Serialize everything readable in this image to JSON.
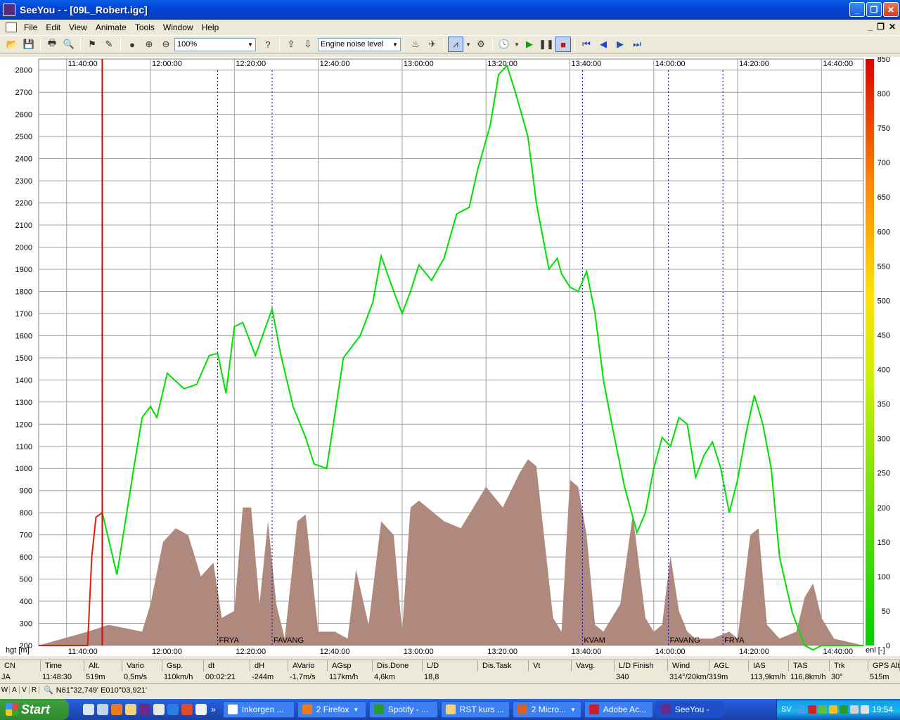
{
  "window": {
    "title": "SeeYou -  - [09L_Robert.igc]"
  },
  "menu": [
    "File",
    "Edit",
    "View",
    "Animate",
    "Tools",
    "Window",
    "Help"
  ],
  "toolbar": {
    "zoom": "100%",
    "channel": "Engine noise level"
  },
  "chart_data": {
    "type": "line",
    "ylabel": "hgt [m]",
    "y2label": "enl [-]",
    "ylim": [
      200,
      2850
    ],
    "y2lim": [
      0,
      850
    ],
    "y_ticks": [
      2800,
      2700,
      2600,
      2500,
      2400,
      2300,
      2200,
      2100,
      2000,
      1900,
      1800,
      1700,
      1600,
      1500,
      1400,
      1300,
      1200,
      1100,
      1000,
      900,
      800,
      700,
      600,
      500,
      400,
      300,
      200
    ],
    "y2_ticks": [
      850,
      800,
      750,
      700,
      650,
      600,
      550,
      500,
      450,
      400,
      350,
      300,
      250,
      200,
      150,
      100,
      50,
      0
    ],
    "x_ticks": [
      "11:40:00",
      "12:00:00",
      "12:20:00",
      "12:40:00",
      "13:00:00",
      "13:20:00",
      "13:40:00",
      "14:00:00",
      "14:20:00",
      "14:40:00"
    ],
    "x_range": [
      "11:33:20",
      "14:50:00"
    ],
    "grid": true,
    "cursor_time": "11:48:30",
    "turnpoints": [
      {
        "time": "12:16:00",
        "label": "FRYA"
      },
      {
        "time": "12:29:00",
        "label": "FAVANG"
      },
      {
        "time": "13:43:00",
        "label": "KVAM"
      },
      {
        "time": "14:03:30",
        "label": "FAVANG"
      },
      {
        "time": "14:16:30",
        "label": "FRYA"
      }
    ],
    "series": [
      {
        "name": "altitude",
        "color": "#00E000",
        "x": [
          "11:33:20",
          "11:40:00",
          "11:45:00",
          "11:46:00",
          "11:47:00",
          "11:48:30",
          "11:52:00",
          "11:56:00",
          "11:58:00",
          "12:00:00",
          "12:01:30",
          "12:04:00",
          "12:08:00",
          "12:11:00",
          "12:14:00",
          "12:16:00",
          "12:18:00",
          "12:20:00",
          "12:22:00",
          "12:25:00",
          "12:29:00",
          "12:31:00",
          "12:34:00",
          "12:37:00",
          "12:39:00",
          "12:42:00",
          "12:46:00",
          "12:50:00",
          "12:53:00",
          "12:55:00",
          "12:58:00",
          "13:00:00",
          "13:02:00",
          "13:04:00",
          "13:07:00",
          "13:10:00",
          "13:13:00",
          "13:16:00",
          "13:18:00",
          "13:21:00",
          "13:23:00",
          "13:25:00",
          "13:27:00",
          "13:30:00",
          "13:32:00",
          "13:34:00",
          "13:35:00",
          "13:37:00",
          "13:38:00",
          "13:40:00",
          "13:42:00",
          "13:44:00",
          "13:46:00",
          "13:48:00",
          "13:50:00",
          "13:53:00",
          "13:56:00",
          "13:58:00",
          "14:00:00",
          "14:02:00",
          "14:04:00",
          "14:06:00",
          "14:08:00",
          "14:10:00",
          "14:12:00",
          "14:14:00",
          "14:16:00",
          "14:18:00",
          "14:20:00",
          "14:22:00",
          "14:24:00",
          "14:26:00",
          "14:28:00",
          "14:30:00",
          "14:33:00",
          "14:36:00",
          "14:38:00",
          "14:40:00",
          "14:42:00",
          "14:45:00",
          "14:47:00",
          "14:50:00"
        ],
        "values": [
          200,
          200,
          200,
          600,
          780,
          800,
          520,
          1000,
          1230,
          1280,
          1230,
          1430,
          1360,
          1380,
          1510,
          1520,
          1340,
          1640,
          1660,
          1510,
          1720,
          1520,
          1280,
          1140,
          1020,
          1000,
          1500,
          1600,
          1750,
          1960,
          1800,
          1700,
          1800,
          1920,
          1850,
          1950,
          2150,
          2180,
          2350,
          2550,
          2780,
          2820,
          2700,
          2500,
          2200,
          2000,
          1900,
          1950,
          1880,
          1820,
          1800,
          1890,
          1700,
          1400,
          1200,
          920,
          710,
          800,
          1000,
          1140,
          1100,
          1230,
          1200,
          960,
          1060,
          1120,
          1000,
          800,
          950,
          1160,
          1330,
          1200,
          1000,
          600,
          350,
          200,
          180,
          200,
          200,
          200,
          200,
          200
        ],
        "pre_release_color": "#E02000",
        "pre_release_until": "11:48:30"
      },
      {
        "name": "enl",
        "color": "#B0897E",
        "x": [
          "11:33:20",
          "11:45:00",
          "11:50:00",
          "11:58:00",
          "12:00:00",
          "12:03:00",
          "12:06:00",
          "12:09:00",
          "12:12:00",
          "12:15:00",
          "12:17:00",
          "12:20:00",
          "12:22:00",
          "12:24:00",
          "12:26:00",
          "12:28:00",
          "12:30:00",
          "12:32:00",
          "12:35:00",
          "12:37:00",
          "12:40:00",
          "12:44:00",
          "12:47:00",
          "12:49:00",
          "12:52:00",
          "12:55:00",
          "12:58:00",
          "13:00:00",
          "13:02:00",
          "13:04:00",
          "13:06:00",
          "13:10:00",
          "13:14:00",
          "13:16:00",
          "13:20:00",
          "13:24:00",
          "13:28:00",
          "13:30:00",
          "13:32:00",
          "13:36:00",
          "13:38:00",
          "13:40:00",
          "13:42:00",
          "13:44:00",
          "13:46:00",
          "13:48:00",
          "13:52:00",
          "13:55:00",
          "13:58:00",
          "14:00:00",
          "14:02:00",
          "14:04:00",
          "14:06:00",
          "14:08:00",
          "14:10:00",
          "14:14:00",
          "14:18:00",
          "14:20:00",
          "14:23:00",
          "14:25:00",
          "14:27:00",
          "14:30:00",
          "14:34:00",
          "14:36:00",
          "14:38:00",
          "14:40:00",
          "14:43:00",
          "14:50:00"
        ],
        "values": [
          0,
          20,
          30,
          20,
          60,
          150,
          170,
          160,
          100,
          120,
          40,
          50,
          200,
          200,
          60,
          180,
          60,
          10,
          180,
          190,
          20,
          20,
          10,
          110,
          30,
          180,
          160,
          20,
          200,
          210,
          200,
          180,
          170,
          190,
          230,
          200,
          250,
          270,
          260,
          40,
          20,
          240,
          230,
          160,
          30,
          20,
          60,
          190,
          40,
          20,
          30,
          130,
          50,
          20,
          10,
          10,
          20,
          10,
          160,
          170,
          30,
          10,
          20,
          70,
          90,
          40,
          10,
          0
        ]
      }
    ]
  },
  "table": {
    "headers": [
      "CN",
      "Time",
      "Alt.",
      "Vario",
      "Gsp.",
      "dt",
      "dH",
      "AVario",
      "AGsp",
      "Dis.Done",
      "L/D",
      "Dis.Task",
      "Vt",
      "Vavg.",
      "L/D Finish",
      "Wind",
      "AGL",
      "IAS",
      "TAS",
      "Trk",
      "GPS Alt."
    ],
    "row": [
      "JA",
      "11:48:30",
      "519m",
      "0,5m/s",
      "110km/h",
      "00:02:21",
      "-244m",
      "-1,7m/s",
      "117km/h",
      "4,6km",
      "18,8",
      "",
      "",
      "",
      "340",
      "314°/20km/319m",
      "",
      "113,9km/h",
      "116,8km/h",
      "30°",
      "515m"
    ]
  },
  "status": {
    "modes": [
      "W",
      "A",
      "V",
      "R"
    ],
    "coords": "N61°32,749'  E010°03,921'"
  },
  "taskbar": {
    "start": "Start",
    "tasks": [
      "Inkorgen ...",
      "2 Firefox",
      "Spotify - ...",
      "RST kurs ...",
      "2 Micro...",
      "Adobe Ac...",
      "SeeYou -"
    ],
    "lang": "SV",
    "clock": "19:54"
  }
}
